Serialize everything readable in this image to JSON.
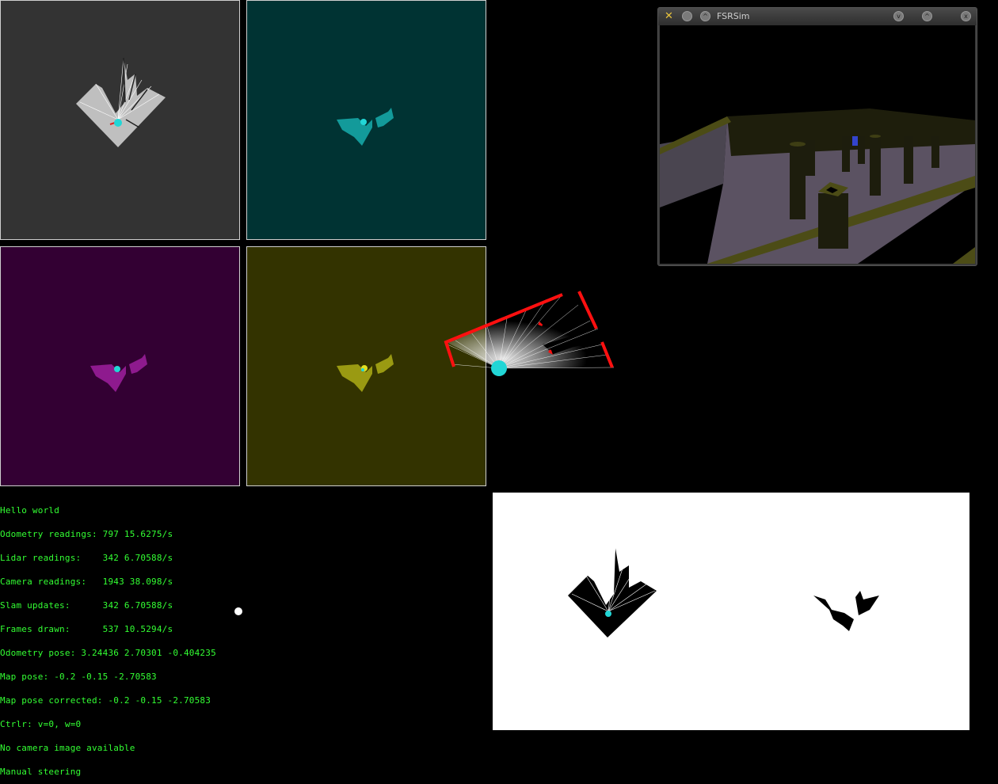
{
  "window": {
    "title": "FSRSim",
    "app_icon": "fsrsim-app-icon",
    "buttons": [
      "menu-button",
      "minimize-button",
      "maximize-button",
      "close-button"
    ]
  },
  "panels": {
    "gray": {
      "background": "#333333",
      "shape": "#bfbfbf"
    },
    "teal": {
      "background": "#003333",
      "shape": "#139a9a"
    },
    "purple": {
      "background": "#330033",
      "shape": "#8e1a8e"
    },
    "olive": {
      "background": "#333300",
      "shape": "#9a9a12"
    }
  },
  "robot_color": "#22d6d6",
  "console": {
    "lines": [
      "Hello world",
      "Odometry readings: 797 15.6275/s",
      "Lidar readings:    342 6.70588/s",
      "Camera readings:   1943 38.098/s",
      "Slam updates:      342 6.70588/s",
      "Frames drawn:      537 10.5294/s",
      "Odometry pose: 3.24436 2.70301 -0.404235",
      "Map pose: -0.2 -0.15 -2.70583",
      "Map pose corrected: -0.2 -0.15 -2.70583",
      "Ctrlr: v=0, w=0",
      "No camera image available",
      "Manual steering"
    ],
    "color": "#33ff33"
  }
}
